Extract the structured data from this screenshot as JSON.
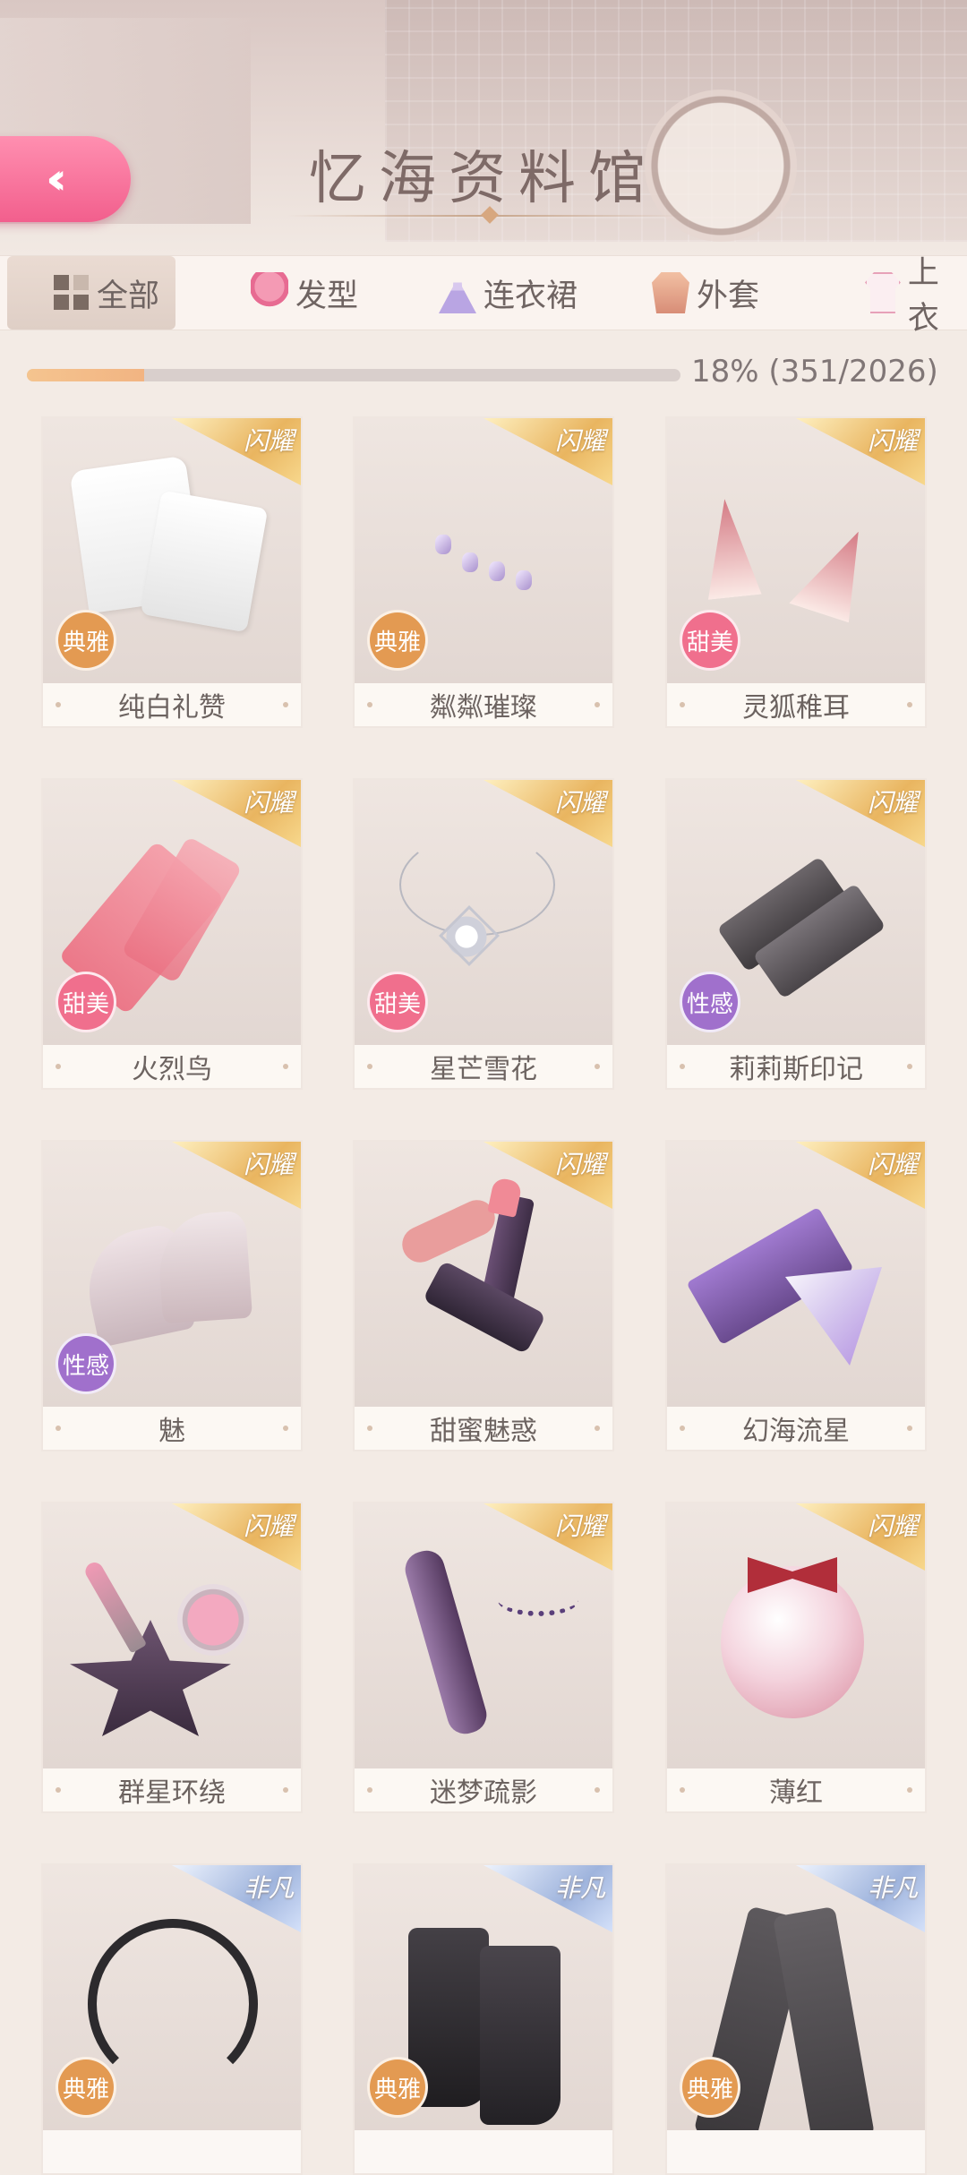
{
  "header": {
    "title": "忆海资料馆",
    "back_icon": "double-chevron-left-icon",
    "back_color": "#f25f8d"
  },
  "tabs": [
    {
      "label": "全部",
      "icon": "grid-icon",
      "active": true
    },
    {
      "label": "发型",
      "icon": "hairstyle-icon",
      "active": false
    },
    {
      "label": "连衣裙",
      "icon": "dress-icon",
      "active": false
    },
    {
      "label": "外套",
      "icon": "coat-icon",
      "active": false
    },
    {
      "label": "上衣",
      "icon": "top-icon",
      "active": false
    }
  ],
  "progress": {
    "percent": 18,
    "text": "18% (351/2026)",
    "collected": 351,
    "total": 2026
  },
  "items": [
    {
      "name": "纯白礼赞",
      "rarity": "闪耀",
      "tag": "典雅"
    },
    {
      "name": "粼粼璀璨",
      "rarity": "闪耀",
      "tag": "典雅"
    },
    {
      "name": "灵狐稚耳",
      "rarity": "闪耀",
      "tag": "甜美"
    },
    {
      "name": "火烈鸟",
      "rarity": "闪耀",
      "tag": "甜美"
    },
    {
      "name": "星芒雪花",
      "rarity": "闪耀",
      "tag": "甜美"
    },
    {
      "name": "莉莉斯印记",
      "rarity": "闪耀",
      "tag": "性感"
    },
    {
      "name": "魅",
      "rarity": "闪耀",
      "tag": "性感"
    },
    {
      "name": "甜蜜魅惑",
      "rarity": "闪耀",
      "tag": ""
    },
    {
      "name": "幻海流星",
      "rarity": "闪耀",
      "tag": ""
    },
    {
      "name": "群星环绕",
      "rarity": "闪耀",
      "tag": ""
    },
    {
      "name": "迷梦疏影",
      "rarity": "闪耀",
      "tag": ""
    },
    {
      "name": "薄红",
      "rarity": "闪耀",
      "tag": ""
    },
    {
      "name": "",
      "rarity": "非凡",
      "tag": "典雅"
    },
    {
      "name": "",
      "rarity": "非凡",
      "tag": "典雅"
    },
    {
      "name": "",
      "rarity": "非凡",
      "tag": "典雅"
    }
  ],
  "colors": {
    "gold_ribbon": "#e9b560",
    "blue_ribbon": "#9fb4dd",
    "elegant": "#e39a52",
    "sweet": "#f06f8d",
    "sexy": "#a070cc"
  }
}
